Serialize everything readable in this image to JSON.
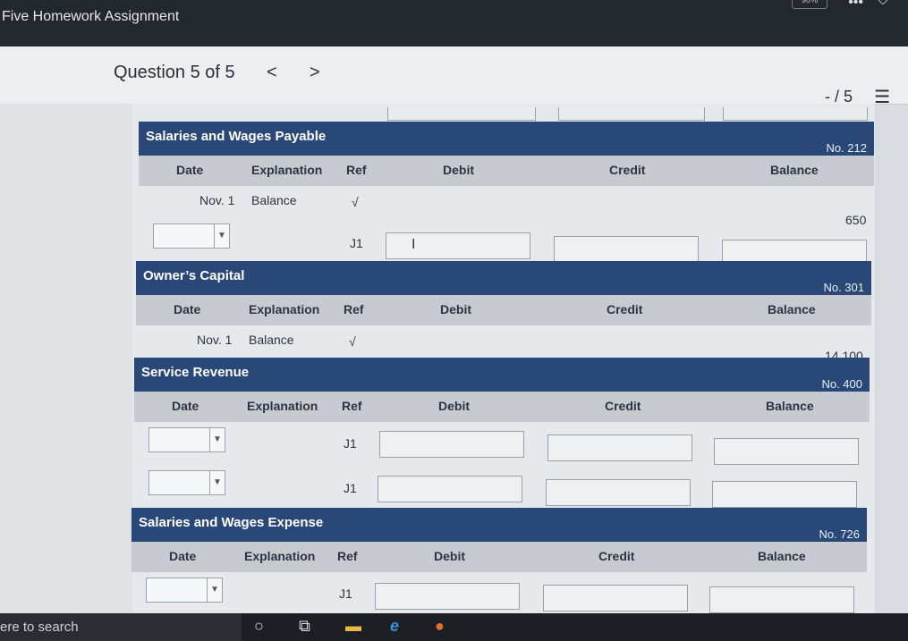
{
  "window": {
    "title": "Five Homework Assignment",
    "zoom": "90%"
  },
  "question": {
    "title": "Question 5 of 5",
    "prev": "<",
    "next": ">",
    "score": "- / 5"
  },
  "columns": {
    "date": "Date",
    "explanation": "Explanation",
    "ref": "Ref",
    "debit": "Debit",
    "credit": "Credit",
    "balance": "Balance"
  },
  "accounts": [
    {
      "name": "Salaries and Wages Payable",
      "no": "No. 212",
      "rows": [
        {
          "date": "Nov. 1",
          "explanation": "Balance",
          "ref": "√",
          "balance": "650"
        },
        {
          "ref": "J1"
        }
      ]
    },
    {
      "name": "Owner’s Capital",
      "no": "No. 301",
      "rows": [
        {
          "date": "Nov. 1",
          "explanation": "Balance",
          "ref": "√",
          "balance": "14,100"
        }
      ]
    },
    {
      "name": "Service Revenue",
      "no": "No. 400",
      "rows": [
        {
          "ref": "J1"
        },
        {
          "ref": "J1"
        }
      ]
    },
    {
      "name": "Salaries and Wages Expense",
      "no": "No. 726",
      "rows": [
        {
          "ref": "J1"
        }
      ]
    }
  ],
  "taskbar": {
    "search_text": "ere to search"
  },
  "icons": [
    "cortana-circle-icon",
    "task-view-icon",
    "file-explorer-icon",
    "edge-icon",
    "firefox-icon",
    "list-icon",
    "more-icon",
    "shield-icon",
    "chevron-left-icon",
    "chevron-right-icon",
    "dropdown-arrow-icon",
    "text-cursor-icon"
  ]
}
